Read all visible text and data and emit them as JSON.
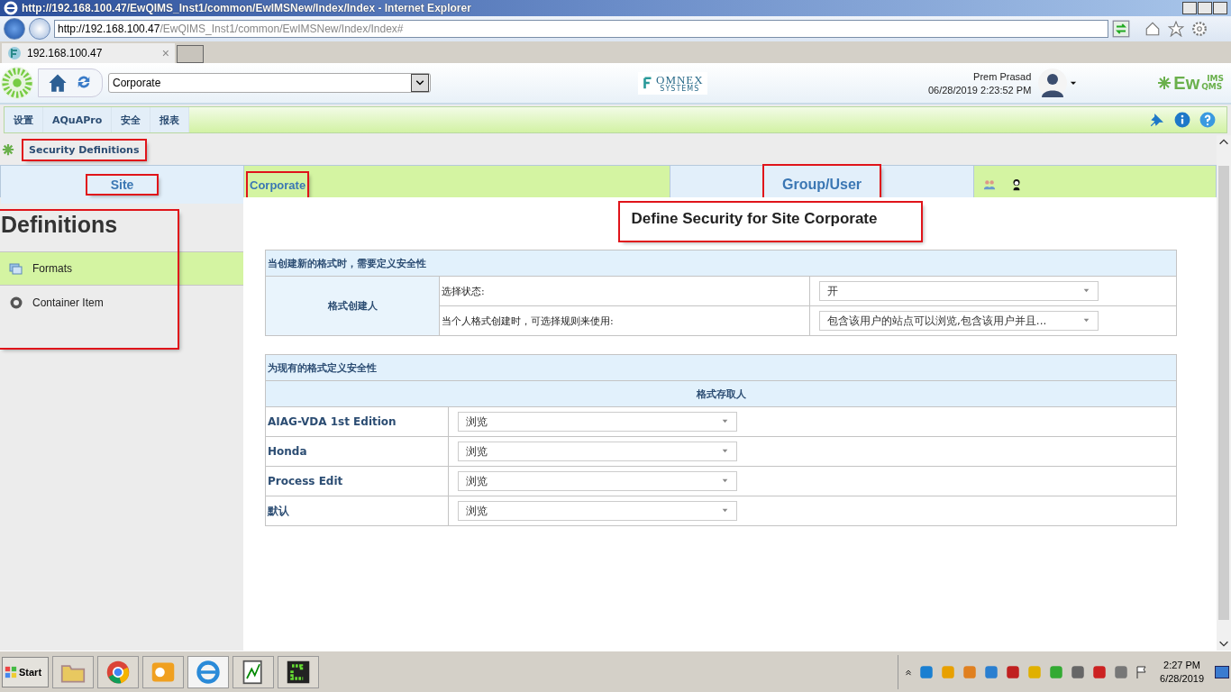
{
  "browser": {
    "title": "http://192.168.100.47/EwQIMS_Inst1/common/EwIMSNew/Index/Index - Internet Explorer",
    "address_host": "http://192.168.100.47",
    "address_path": "/EwQIMS_Inst1/common/EwIMSNew/Index/Index#",
    "tab_title": "192.168.100.47",
    "tab_close": "×"
  },
  "app": {
    "site_select": "Corporate",
    "vendor_logo": "OMNEX",
    "vendor_sub": "SYSTEMS",
    "user_name": "Prem Prasad",
    "datetime": "06/28/2019 2:23:52 PM",
    "product_logo": "Ew",
    "product_sup": "IMS",
    "product_sub": "QMS",
    "menu": [
      {
        "label": "设置"
      },
      {
        "label": "AQuAPro"
      },
      {
        "label": "安全"
      },
      {
        "label": "报表"
      }
    ]
  },
  "breadcrumb": {
    "label": "Security Definitions",
    "highlighted": true
  },
  "site_bar": {
    "site_label": "Site",
    "site_label_highlighted": true,
    "site_value": "Corporate",
    "site_value_highlighted": true,
    "group_user": "Group/User",
    "group_user_highlighted": true
  },
  "sidebar": {
    "heading": "Definitions",
    "highlighted": true,
    "items": [
      {
        "label": "Formats",
        "kind": "formats",
        "selected": true
      },
      {
        "label": "Container Item",
        "kind": "container",
        "selected": false
      }
    ]
  },
  "content": {
    "title": "Define Security for Site Corporate",
    "title_highlighted": true,
    "new_formats": {
      "heading": "当创建新的格式时，需要定义安全性",
      "creator_label": "格式创建人",
      "rows": [
        {
          "label": "选择状态:",
          "value": "开"
        },
        {
          "label": "当个人格式创建时，可选择规则来使用:",
          "value": "包含该用户的站点可以浏览,包含该用户并且..."
        }
      ]
    },
    "existing": {
      "heading": "为现有的格式定义安全性",
      "column_header": "格式存取人",
      "rows": [
        {
          "name": "AIAG-VDA 1st Edition",
          "value": "浏览"
        },
        {
          "name": "Honda",
          "value": "浏览"
        },
        {
          "name": "Process Edit",
          "value": "浏览"
        },
        {
          "name": "默认",
          "value": "浏览"
        }
      ]
    }
  },
  "taskbar": {
    "start_label": "Start",
    "time": "2:27 PM",
    "date": "6/28/2019"
  }
}
